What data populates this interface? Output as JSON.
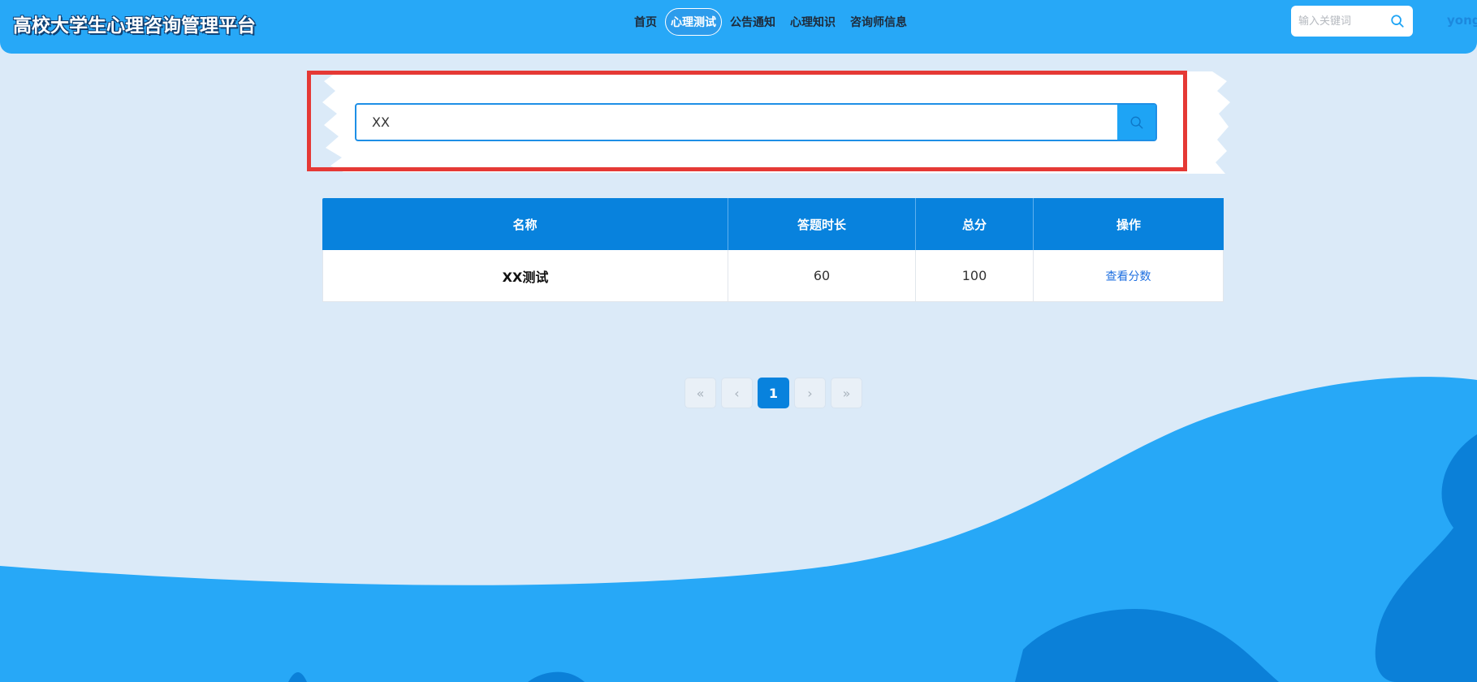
{
  "header": {
    "title": "高校大学生心理咨询管理平台",
    "nav": [
      {
        "label": "首页",
        "active": false
      },
      {
        "label": "心理测试",
        "active": true
      },
      {
        "label": "公告通知",
        "active": false
      },
      {
        "label": "心理知识",
        "active": false
      },
      {
        "label": "咨询师信息",
        "active": false
      }
    ],
    "search_placeholder": "输入关键词",
    "search_icon": "search-icon",
    "username": "yong"
  },
  "search": {
    "value": "XX",
    "button_icon": "search-icon"
  },
  "table": {
    "columns": [
      "名称",
      "答题时长",
      "总分",
      "操作"
    ],
    "rows": [
      {
        "name": "XX测试",
        "duration": "60",
        "score": "100",
        "action": "查看分数"
      }
    ]
  },
  "pagination": {
    "first": "«",
    "prev": "‹",
    "current": "1",
    "next": "›",
    "last": "»"
  },
  "colors": {
    "header_bg": "#27a8f7",
    "page_bg": "#dbeaf8",
    "table_header_bg": "#0882dd",
    "highlight_frame": "#e53935",
    "wave_light": "#27a8f7",
    "wave_dark": "#0b80d8"
  }
}
